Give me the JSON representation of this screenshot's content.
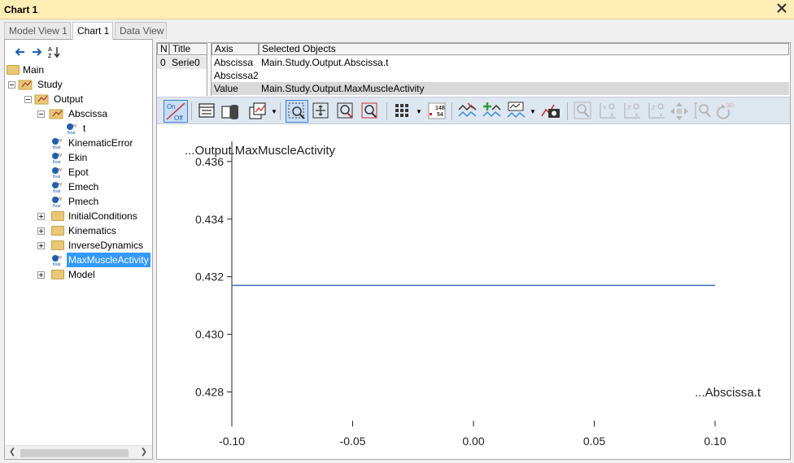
{
  "window": {
    "title": "Chart 1"
  },
  "tabs": [
    {
      "label": "Model View 1",
      "active": false
    },
    {
      "label": "Chart 1",
      "active": true
    },
    {
      "label": "Data View",
      "active": false
    }
  ],
  "tree": [
    {
      "label": "Main",
      "level": 0,
      "kind": "folder",
      "expander": "none"
    },
    {
      "label": "Study",
      "level": 1,
      "kind": "study",
      "expander": "minus"
    },
    {
      "label": "Output",
      "level": 2,
      "kind": "study",
      "expander": "minus"
    },
    {
      "label": "Abscissa",
      "level": 3,
      "kind": "study",
      "expander": "minus"
    },
    {
      "label": "t",
      "level": 4,
      "kind": "float",
      "expander": "none"
    },
    {
      "label": "KinematicError",
      "level": 3,
      "kind": "float",
      "expander": "none"
    },
    {
      "label": "Ekin",
      "level": 3,
      "kind": "float",
      "expander": "none"
    },
    {
      "label": "Epot",
      "level": 3,
      "kind": "float",
      "expander": "none"
    },
    {
      "label": "Emech",
      "level": 3,
      "kind": "float",
      "expander": "none"
    },
    {
      "label": "Pmech",
      "level": 3,
      "kind": "float",
      "expander": "none"
    },
    {
      "label": "InitialConditions",
      "level": 3,
      "kind": "folder",
      "expander": "plus"
    },
    {
      "label": "Kinematics",
      "level": 3,
      "kind": "folder",
      "expander": "plus"
    },
    {
      "label": "InverseDynamics",
      "level": 3,
      "kind": "folder",
      "expander": "plus"
    },
    {
      "label": "MaxMuscleActivity",
      "level": 3,
      "kind": "float",
      "expander": "none",
      "selected": true
    },
    {
      "label": "Model",
      "level": 3,
      "kind": "folder",
      "expander": "plus"
    }
  ],
  "series_table": {
    "headers": [
      "N",
      "Title"
    ],
    "rows": [
      [
        "0",
        "Serie0"
      ]
    ]
  },
  "axis_table": {
    "headers": [
      "Axis",
      "Selected Objects"
    ],
    "rows": [
      {
        "axis": "Abscissa",
        "object": "Main.Study.Output.Abscissa.t",
        "selected": false
      },
      {
        "axis": "Abscissa2",
        "object": "",
        "selected": false
      },
      {
        "axis": "Value",
        "object": "Main.Study.Output.MaxMuscleActivity",
        "selected": true
      }
    ]
  },
  "toolbar": {
    "onoff_top": "On",
    "onoff_bottom": "Off",
    "numbers_top": "148",
    "numbers_bottom": "54",
    "label_3d": "3D"
  },
  "chart_data": {
    "type": "line",
    "ylabel": "...Output.MaxMuscleActivity",
    "xlabel": "...Abscissa.t",
    "xlim": [
      -0.1,
      0.1
    ],
    "ylim": [
      0.427,
      0.4367
    ],
    "x_ticks": [
      "-0.10",
      "-0.05",
      "0.00",
      "0.05",
      "0.10"
    ],
    "x_tick_values": [
      -0.1,
      -0.05,
      0.0,
      0.05,
      0.1
    ],
    "y_ticks": [
      "0.428",
      "0.430",
      "0.432",
      "0.434",
      "0.436"
    ],
    "y_tick_values": [
      0.428,
      0.43,
      0.432,
      0.434,
      0.436
    ],
    "series": [
      {
        "x": [
          -0.1,
          0.1
        ],
        "y": [
          0.4317,
          0.4317
        ],
        "color": "#3b6fb0"
      }
    ]
  },
  "colors": {
    "accent": "#3399ff",
    "titlebar": "#ffeeb5",
    "toolbar": "#dee6f0",
    "series": "#3b6fb0"
  }
}
